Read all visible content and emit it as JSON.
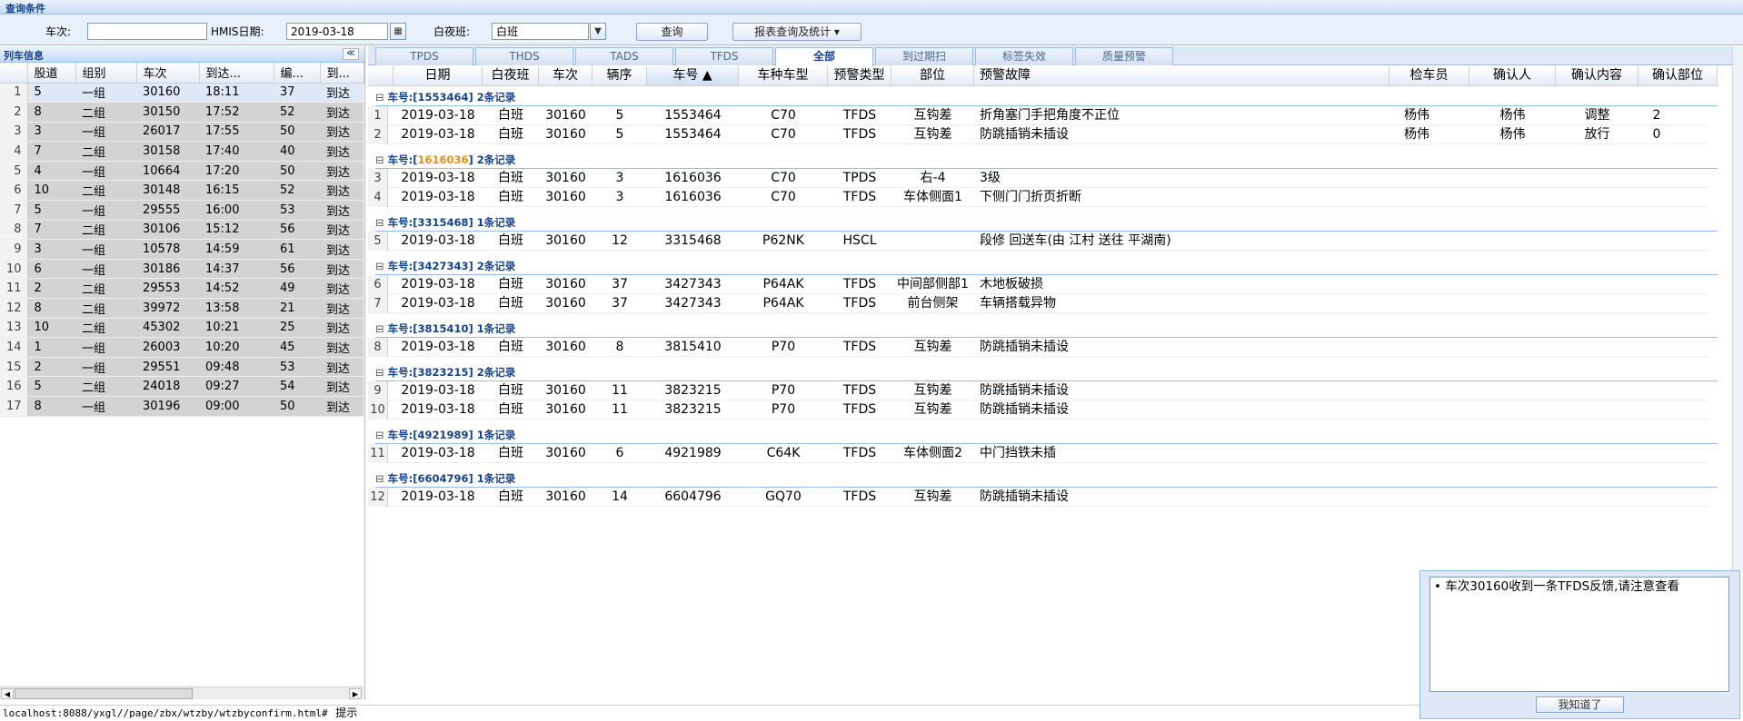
{
  "query": {
    "title": "查询条件",
    "train_label": "车次:",
    "train_value": "",
    "date_label": "HMIS日期:",
    "date_value": "2019-03-18",
    "shift_label": "白夜班:",
    "shift_value": "白班",
    "search_label": "查询",
    "report_label": "报表查询及统计 ▾"
  },
  "left": {
    "title": "列车信息",
    "collapse": "≪",
    "columns": [
      "股道",
      "组别",
      "车次",
      "到达...",
      "编...",
      "到..."
    ],
    "rows": [
      [
        "1",
        "5",
        "一组",
        "30160",
        "18:11",
        "37",
        "到达"
      ],
      [
        "2",
        "8",
        "二组",
        "30150",
        "17:52",
        "52",
        "到达"
      ],
      [
        "3",
        "3",
        "一组",
        "26017",
        "17:55",
        "50",
        "到达"
      ],
      [
        "4",
        "7",
        "二组",
        "30158",
        "17:40",
        "40",
        "到达"
      ],
      [
        "5",
        "4",
        "一组",
        "10664",
        "17:20",
        "50",
        "到达"
      ],
      [
        "6",
        "10",
        "二组",
        "30148",
        "16:15",
        "52",
        "到达"
      ],
      [
        "7",
        "5",
        "一组",
        "29555",
        "16:00",
        "53",
        "到达"
      ],
      [
        "8",
        "7",
        "二组",
        "30106",
        "15:12",
        "56",
        "到达"
      ],
      [
        "9",
        "3",
        "一组",
        "10578",
        "14:59",
        "61",
        "到达"
      ],
      [
        "10",
        "6",
        "一组",
        "30186",
        "14:37",
        "56",
        "到达"
      ],
      [
        "11",
        "2",
        "二组",
        "29553",
        "14:52",
        "49",
        "到达"
      ],
      [
        "12",
        "8",
        "二组",
        "39972",
        "13:58",
        "21",
        "到达"
      ],
      [
        "13",
        "10",
        "二组",
        "45302",
        "10:21",
        "25",
        "到达"
      ],
      [
        "14",
        "1",
        "一组",
        "26003",
        "10:20",
        "45",
        "到达"
      ],
      [
        "15",
        "2",
        "一组",
        "29551",
        "09:48",
        "53",
        "到达"
      ],
      [
        "16",
        "5",
        "二组",
        "24018",
        "09:27",
        "54",
        "到达"
      ],
      [
        "17",
        "8",
        "一组",
        "30196",
        "09:00",
        "50",
        "到达"
      ]
    ]
  },
  "tabs": [
    "TPDS",
    "THDS",
    "TADS",
    "TFDS",
    "全部",
    "到过期扫",
    "标签失效",
    "质量预警"
  ],
  "grid": {
    "columns": [
      "日期",
      "白夜班",
      "车次",
      "辆序",
      "车号 ▲",
      "车种车型",
      "预警类型",
      "部位",
      "预警故障",
      "检车员",
      "确认人",
      "确认内容",
      "确认部位"
    ],
    "groups": [
      {
        "prefix": "车号:[",
        "car": "1553464",
        "suffix": "] 2条记录",
        "highlight": false,
        "rows": [
          [
            "1",
            "2019-03-18",
            "白班",
            "30160",
            "5",
            "1553464",
            "C70",
            "TFDS",
            "互钩差",
            "折角塞门手把角度不正位",
            "杨伟",
            "杨伟",
            "调整",
            "2"
          ],
          [
            "2",
            "2019-03-18",
            "白班",
            "30160",
            "5",
            "1553464",
            "C70",
            "TFDS",
            "互钩差",
            "防跳插销未插设",
            "杨伟",
            "杨伟",
            "放行",
            "0"
          ]
        ]
      },
      {
        "prefix": "车号:[",
        "car": "1616036",
        "suffix": "] 2条记录",
        "highlight": true,
        "rows": [
          [
            "3",
            "2019-03-18",
            "白班",
            "30160",
            "3",
            "1616036",
            "C70",
            "TPDS",
            "右-4",
            "3级",
            "",
            "",
            "",
            ""
          ],
          [
            "4",
            "2019-03-18",
            "白班",
            "30160",
            "3",
            "1616036",
            "C70",
            "TFDS",
            "车体侧面1",
            "下侧门门折页折断",
            "",
            "",
            "",
            ""
          ]
        ]
      },
      {
        "prefix": "车号:[",
        "car": "3315468",
        "suffix": "] 1条记录",
        "highlight": false,
        "rows": [
          [
            "5",
            "2019-03-18",
            "白班",
            "30160",
            "12",
            "3315468",
            "P62NK",
            "HSCL",
            "",
            "段修 回送车(由 江村 送往 平湖南)",
            "",
            "",
            "",
            ""
          ]
        ]
      },
      {
        "prefix": "车号:[",
        "car": "3427343",
        "suffix": "] 2条记录",
        "highlight": false,
        "rows": [
          [
            "6",
            "2019-03-18",
            "白班",
            "30160",
            "37",
            "3427343",
            "P64AK",
            "TFDS",
            "中间部侧部1",
            "木地板破损",
            "",
            "",
            "",
            ""
          ],
          [
            "7",
            "2019-03-18",
            "白班",
            "30160",
            "37",
            "3427343",
            "P64AK",
            "TFDS",
            "前台侧架",
            "车辆搭载异物",
            "",
            "",
            "",
            ""
          ]
        ]
      },
      {
        "prefix": "车号:[",
        "car": "3815410",
        "suffix": "] 1条记录",
        "highlight": false,
        "rows": [
          [
            "8",
            "2019-03-18",
            "白班",
            "30160",
            "8",
            "3815410",
            "P70",
            "TFDS",
            "互钩差",
            "防跳插销未插设",
            "",
            "",
            "",
            ""
          ]
        ]
      },
      {
        "prefix": "车号:[",
        "car": "3823215",
        "suffix": "] 2条记录",
        "highlight": false,
        "rows": [
          [
            "9",
            "2019-03-18",
            "白班",
            "30160",
            "11",
            "3823215",
            "P70",
            "TFDS",
            "互钩差",
            "防跳插销未插设",
            "",
            "",
            "",
            ""
          ],
          [
            "10",
            "2019-03-18",
            "白班",
            "30160",
            "11",
            "3823215",
            "P70",
            "TFDS",
            "互钩差",
            "防跳插销未插设",
            "",
            "",
            "",
            ""
          ]
        ]
      },
      {
        "prefix": "车号:[",
        "car": "4921989",
        "suffix": "] 1条记录",
        "highlight": false,
        "rows": [
          [
            "11",
            "2019-03-18",
            "白班",
            "30160",
            "6",
            "4921989",
            "C64K",
            "TFDS",
            "车体侧面2",
            "中门挡铁未插",
            "",
            "",
            "",
            ""
          ]
        ]
      },
      {
        "prefix": "车号:[",
        "car": "6604796",
        "suffix": "] 1条记录",
        "highlight": false,
        "rows": [
          [
            "12",
            "2019-03-18",
            "白班",
            "30160",
            "14",
            "6604796",
            "GQ70",
            "TFDS",
            "互钩差",
            "防跳插销未插设",
            "",
            "",
            "",
            ""
          ]
        ]
      }
    ]
  },
  "popup": {
    "message": "• 车次30160收到一条TFDS反馈,请注意查看",
    "button": "我知道了"
  },
  "status": {
    "url": "localhost:8088/yxgl//page/zbx/wtzby/wtzbyconfirm.html#",
    "tip": "提示"
  }
}
